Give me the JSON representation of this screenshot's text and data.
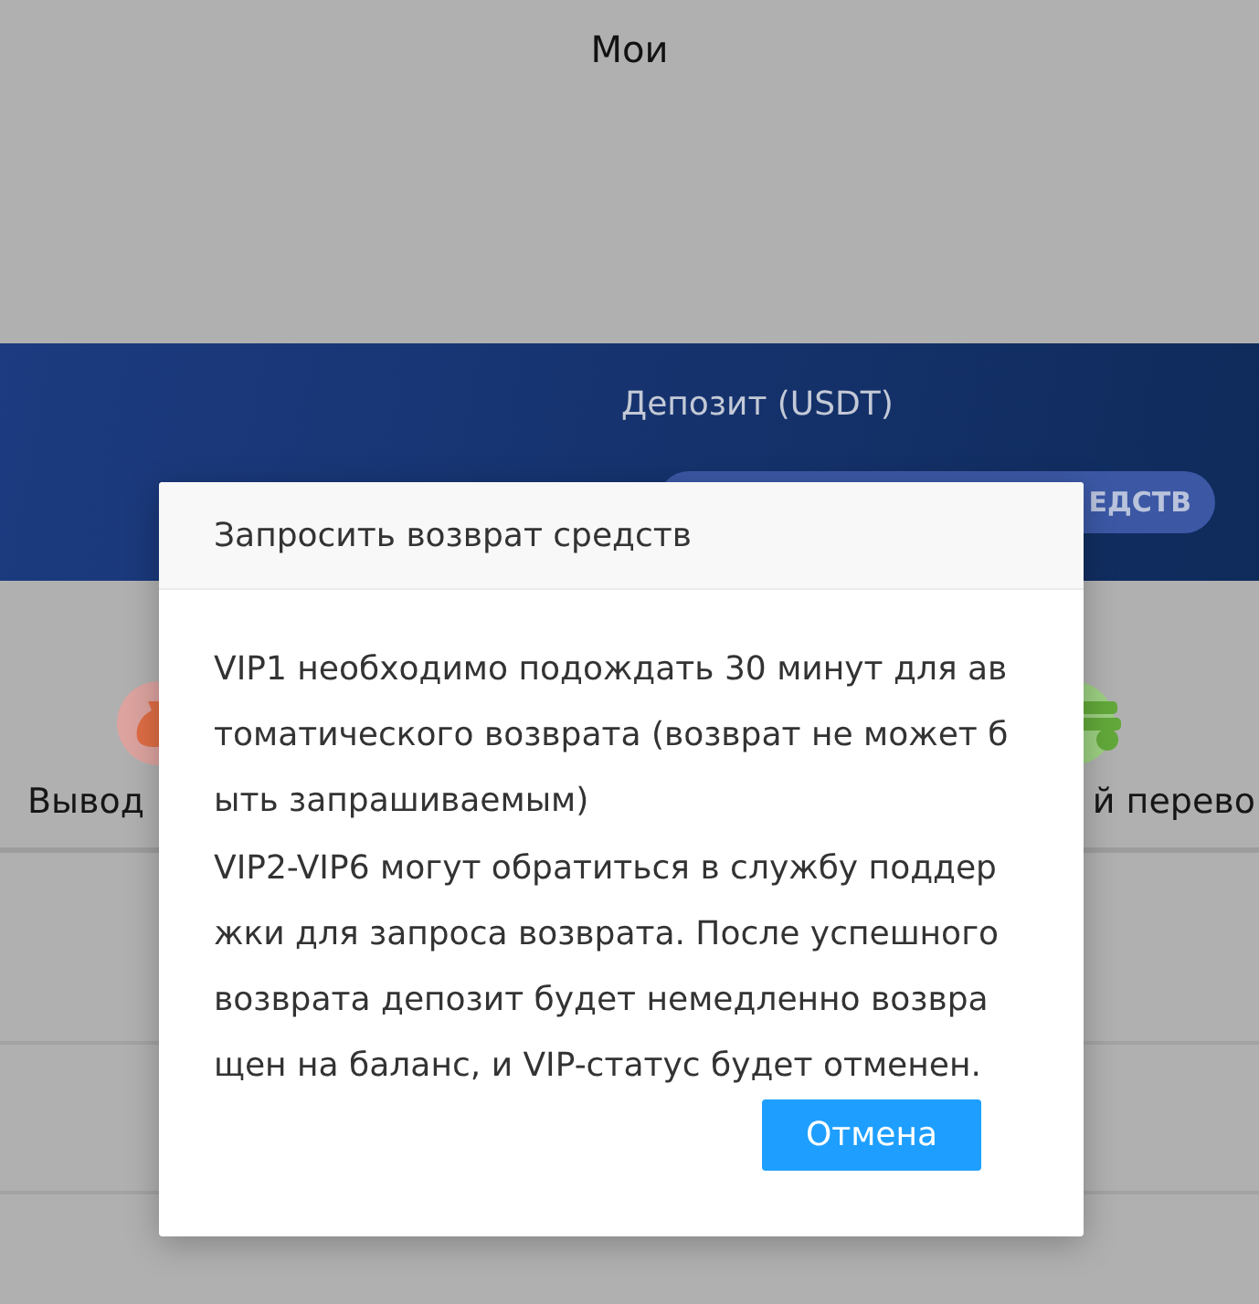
{
  "header": {
    "title": "Мои"
  },
  "deposit_banner": {
    "label": "Депозит (USDT)",
    "button": "ЕДСТВ"
  },
  "actions": [
    {
      "kind": "withdraw",
      "label": "Вывод"
    },
    {
      "kind": "transfer",
      "label": "й перево"
    }
  ],
  "dialog": {
    "title": "Запросить возврат средств",
    "paragraphs": [
      "VIP1 необходимо подождать 30 минут для автоматического возврата (возврат не может быть запрашиваемым)",
      "VIP2-VIP6 могут обратиться в службу поддержки для запроса возврата. После успешного возврата депозит будет немедленно возвращен на баланс, и VIP-статус будет отменен."
    ],
    "buttons": [
      {
        "label": "Отмена"
      }
    ]
  }
}
